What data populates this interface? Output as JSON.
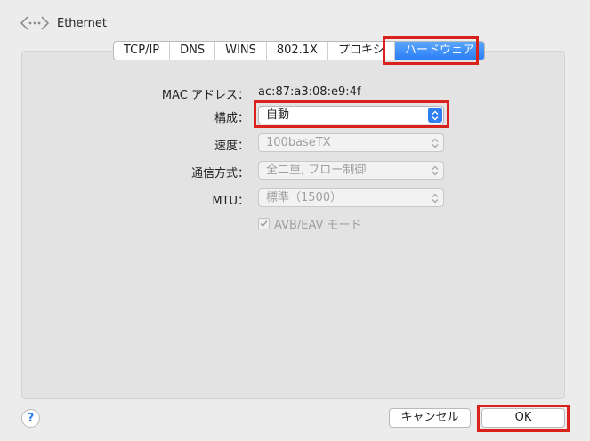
{
  "header": {
    "title": "Ethernet",
    "icon": "network-arrows-icon"
  },
  "tabs": [
    {
      "label": "TCP/IP"
    },
    {
      "label": "DNS"
    },
    {
      "label": "WINS"
    },
    {
      "label": "802.1X"
    },
    {
      "label": "プロキシ"
    },
    {
      "label": "ハードウェア",
      "active": true
    }
  ],
  "hardware": {
    "mac_label": "MAC アドレス：",
    "mac_value": "ac:87:a3:08:e9:4f",
    "config_label": "構成：",
    "config_value": "自動",
    "speed_label": "速度：",
    "speed_value": "100baseTX",
    "duplex_label": "通信方式：",
    "duplex_value": "全二重, フロー制御",
    "mtu_label": "MTU：",
    "mtu_value": "標準（1500）",
    "avb_label": "AVB/EAV モード",
    "avb_checked": true
  },
  "footer": {
    "help_label": "?",
    "cancel_label": "キャンセル",
    "ok_label": "OK"
  },
  "colors": {
    "accent": "#2a7ef5",
    "highlight": "#d9221c",
    "panel": "#e3e3e3"
  }
}
